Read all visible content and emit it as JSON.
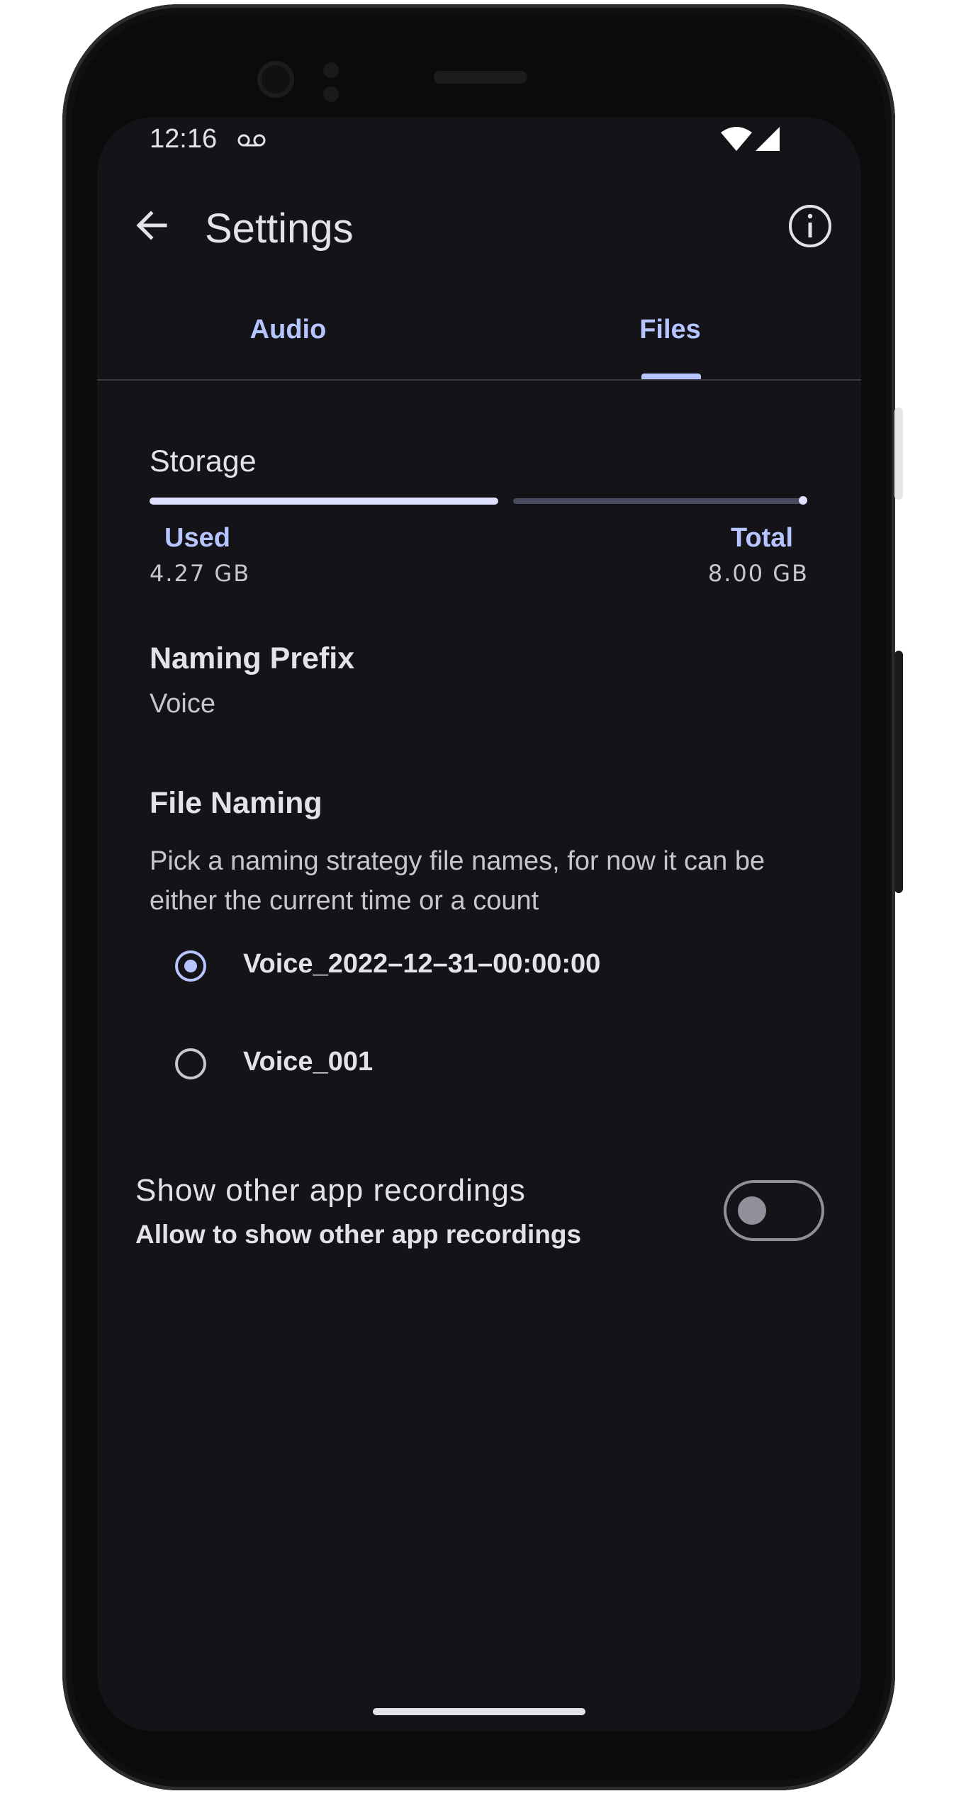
{
  "status_bar": {
    "time": "12:16"
  },
  "app_bar": {
    "title": "Settings"
  },
  "tabs": [
    {
      "label": "Audio",
      "selected": false
    },
    {
      "label": "Files",
      "selected": true
    }
  ],
  "storage": {
    "title": "Storage",
    "used_label": "Used",
    "used_value": "4.27 GB",
    "total_label": "Total",
    "total_value": "8.00 GB",
    "used_fraction": 0.53
  },
  "naming_prefix": {
    "title": "Naming Prefix",
    "value": "Voice"
  },
  "file_naming": {
    "title": "File Naming",
    "description": "Pick a naming strategy file names, for now it can be either the current time or a count",
    "options": [
      {
        "label": "Voice_2022–12–31–00:00:00",
        "selected": true
      },
      {
        "label": "Voice_001",
        "selected": false
      }
    ]
  },
  "other_recordings": {
    "title": "Show other app recordings",
    "subtitle": "Allow to show other app recordings",
    "enabled": false
  },
  "colors": {
    "background": "#131318",
    "accent": "#b6c4ff",
    "text": "#e4e1e9",
    "muted": "#c6c6d0"
  }
}
